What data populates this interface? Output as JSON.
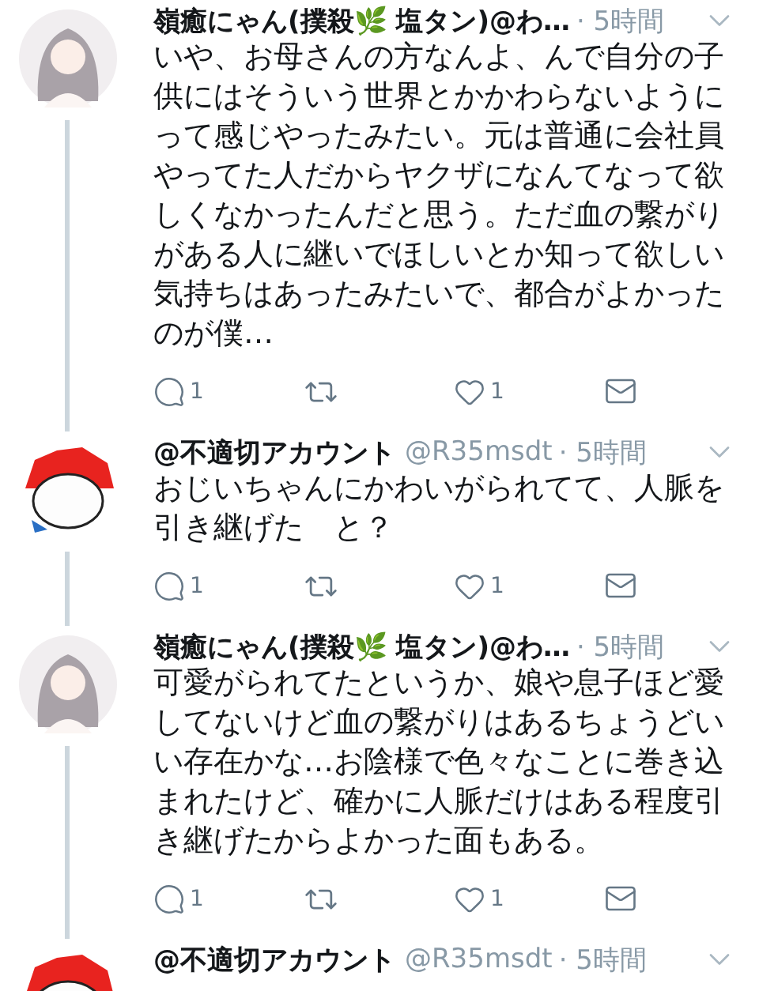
{
  "tweets": [
    {
      "name": "嶺癒にゃん(撲殺🌿 塩タン)@わ…",
      "time": "· 5時間",
      "avatar": {
        "kind": "girl"
      },
      "threaded": true,
      "body": "いや、お母さんの方なんよ、んで自分の子供にはそういう世界とかかわらないようにって感じやったみたい。元は普通に会社員やってた人だからヤクザになんてなって欲しくなかったんだと思う。ただ血の繋がりがある人に継いでほしいとか知って欲しい気持ちはあったみたいで、都合がよかったのが僕…",
      "actions": {
        "replies": "1",
        "likes": "1"
      }
    },
    {
      "name": "@不適切アカウント",
      "handle": "@R35msdt",
      "time": "· 5時間",
      "avatar": {
        "kind": "mascot"
      },
      "threaded": true,
      "body": "おじいちゃんにかわいがられてて、人脈を引き継げた　と？",
      "actions": {
        "replies": "1",
        "likes": "1"
      }
    },
    {
      "name": "嶺癒にゃん(撲殺🌿 塩タン)@わ…",
      "time": "· 5時間",
      "avatar": {
        "kind": "girl"
      },
      "threaded": true,
      "body": "可愛がられてたというか、娘や息子ほど愛してないけど血の繋がりはあるちょうどいい存在かな…お陰様で色々なことに巻き込まれたけど、確かに人脈だけはある程度引き継げたからよかった面もある。",
      "actions": {
        "replies": "1",
        "likes": "1"
      }
    },
    {
      "name": "@不適切アカウント",
      "handle": "@R35msdt",
      "time": "· 5時間",
      "avatar": {
        "kind": "mascot"
      }
    }
  ]
}
